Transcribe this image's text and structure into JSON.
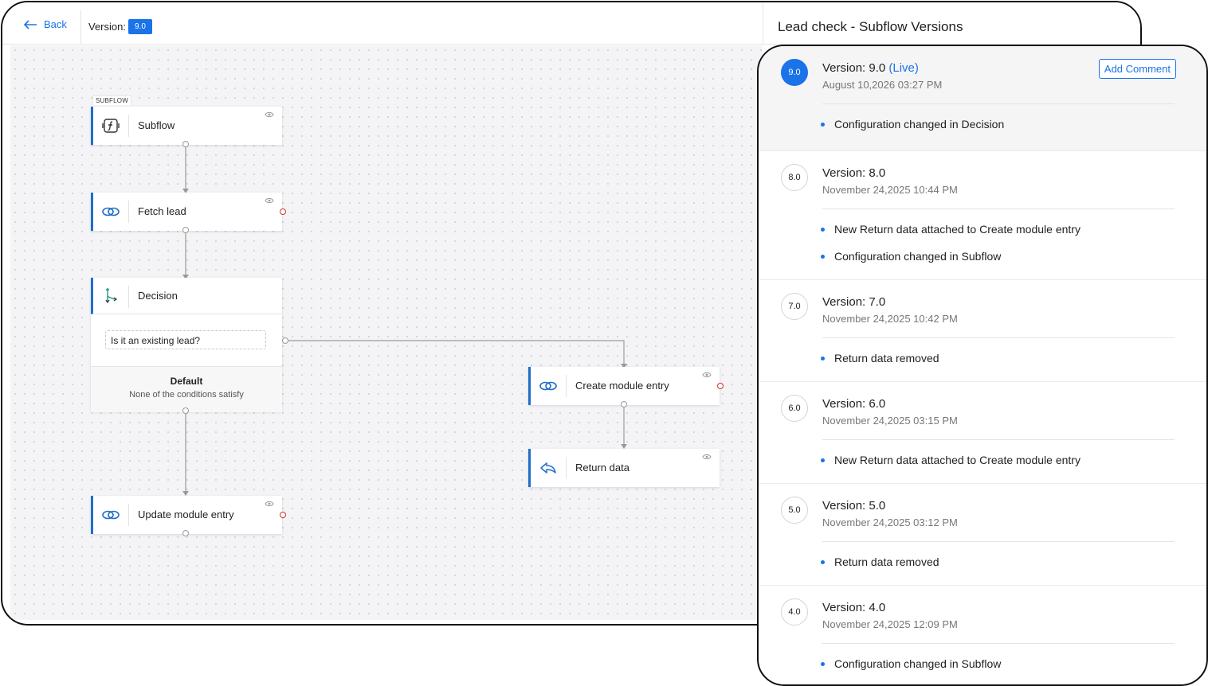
{
  "header": {
    "back_label": "Back",
    "version_label": "Version:",
    "version_value": "9.0",
    "panel_title": "Lead check - Subflow Versions"
  },
  "flow": {
    "subflow_tag": "SUBFLOW",
    "nodes": {
      "subflow": "Subflow",
      "fetch_lead": "Fetch lead",
      "decision": "Decision",
      "create_module_entry": "Create module entry",
      "return_data": "Return data",
      "update_module_entry": "Update module entry"
    },
    "decision": {
      "condition": "Is it an existing lead?",
      "default_title": "Default",
      "default_sub": "None of the conditions satisfy"
    }
  },
  "versions": {
    "add_comment_label": "Add Comment",
    "items": [
      {
        "badge": "9.0",
        "title": "Version: 9.0",
        "live_label": "(Live)",
        "date": "August 10,2026 03:27 PM",
        "changes": [
          "Configuration changed in Decision"
        ]
      },
      {
        "badge": "8.0",
        "title": "Version: 8.0",
        "date": "November 24,2025 10:44 PM",
        "changes": [
          "New Return data attached to Create module entry",
          "Configuration changed in Subflow"
        ]
      },
      {
        "badge": "7.0",
        "title": "Version: 7.0",
        "date": "November 24,2025 10:42 PM",
        "changes": [
          "Return data removed"
        ]
      },
      {
        "badge": "6.0",
        "title": "Version: 6.0",
        "date": "November 24,2025 03:15 PM",
        "changes": [
          "New Return data attached to Create module entry"
        ]
      },
      {
        "badge": "5.0",
        "title": "Version: 5.0",
        "date": "November 24,2025 03:12 PM",
        "changes": [
          "Return data removed"
        ]
      },
      {
        "badge": "4.0",
        "title": "Version: 4.0",
        "date": "November 24,2025 12:09 PM",
        "changes": [
          "Configuration changed in Subflow"
        ]
      }
    ]
  },
  "colors": {
    "accent": "#1a73e8",
    "node_border": "#1f6fc9",
    "port_error": "#d0312d"
  }
}
